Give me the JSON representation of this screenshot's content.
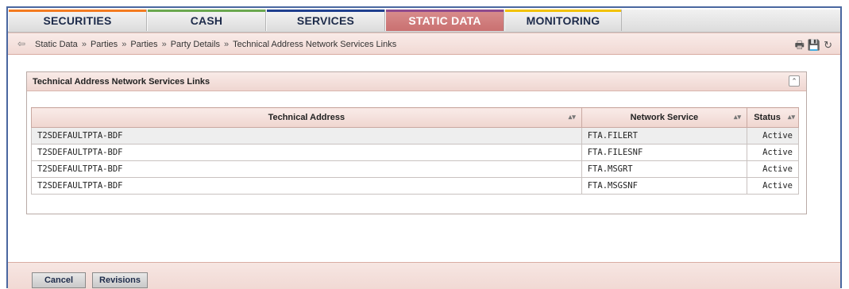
{
  "nav": {
    "tabs": [
      {
        "label": "SECURITIES",
        "color": "#f47b20"
      },
      {
        "label": "CASH",
        "color": "#6aa84f"
      },
      {
        "label": "SERVICES",
        "color": "#1f3f8f"
      },
      {
        "label": "STATIC DATA",
        "color": "#8e4a8e"
      },
      {
        "label": "MONITORING",
        "color": "#f2c200"
      }
    ],
    "active": "STATIC DATA"
  },
  "breadcrumb": {
    "back_icon": "back-arrow-icon",
    "items": [
      "Static Data",
      "Parties",
      "Parties",
      "Party Details",
      "Technical Address Network Services Links"
    ],
    "separator": "»",
    "tools": [
      "print-icon",
      "save-icon",
      "refresh-icon"
    ]
  },
  "panel": {
    "title": "Technical Address Network Services Links",
    "columns": [
      "Technical Address",
      "Network Service",
      "Status"
    ],
    "rows": [
      {
        "technical_address": "T2SDEFAULTPTA-BDF",
        "network_service": "FTA.FILERT",
        "status": "Active"
      },
      {
        "technical_address": "T2SDEFAULTPTA-BDF",
        "network_service": "FTA.FILESNF",
        "status": "Active"
      },
      {
        "technical_address": "T2SDEFAULTPTA-BDF",
        "network_service": "FTA.MSGRT",
        "status": "Active"
      },
      {
        "technical_address": "T2SDEFAULTPTA-BDF",
        "network_service": "FTA.MSGSNF",
        "status": "Active"
      }
    ]
  },
  "footer": {
    "cancel_label": "Cancel",
    "revisions_label": "Revisions"
  }
}
